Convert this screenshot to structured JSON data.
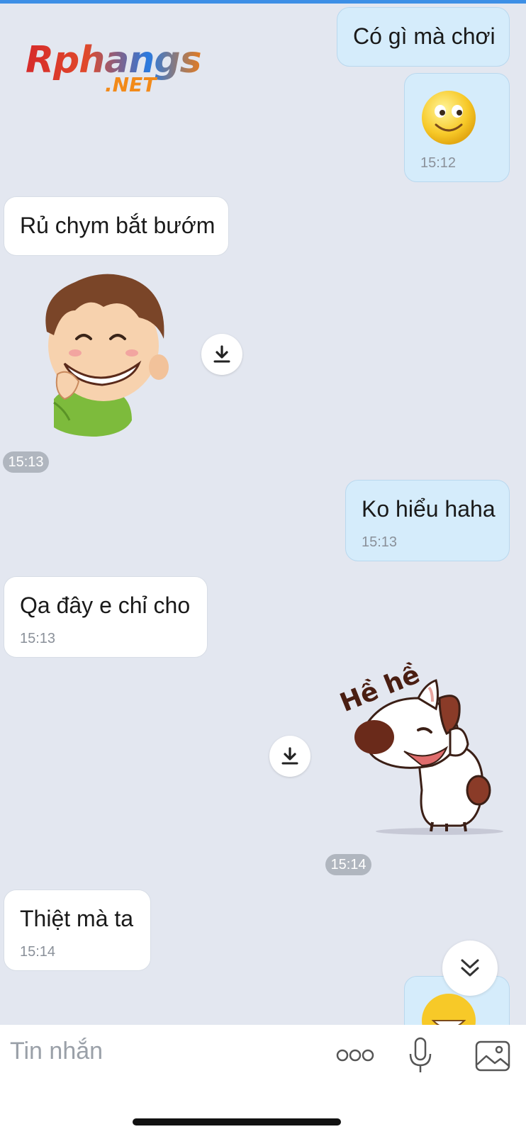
{
  "watermark": {
    "brand": "Rphangs",
    "suffix": ".NET"
  },
  "messages": [
    {
      "side": "out",
      "text": "Có gì mà chơi"
    },
    {
      "side": "out",
      "type": "emoji",
      "time": "15:12"
    },
    {
      "side": "in",
      "text": "Rủ chym bắt bướm"
    },
    {
      "side": "in",
      "type": "sticker",
      "time": "15:13"
    },
    {
      "side": "out",
      "text": "Ko hiểu haha",
      "time": "15:13"
    },
    {
      "side": "in",
      "text": "Qa đây e chỉ cho",
      "time": "15:13"
    },
    {
      "side": "out",
      "type": "sticker",
      "sticker_text": "Hề hề",
      "time": "15:14"
    },
    {
      "side": "in",
      "text": "Thiệt mà ta",
      "time": "15:14"
    }
  ],
  "composer": {
    "placeholder": "Tin nhắn"
  },
  "icons": {
    "download": "download-icon",
    "scroll_down": "double-chevron-down-icon",
    "more": "more-icon",
    "mic": "microphone-icon",
    "image": "image-icon"
  },
  "colors": {
    "background": "#e3e7f0",
    "outgoing": "#d5ecfb",
    "incoming": "#ffffff",
    "accent": "#3d8fe6"
  }
}
